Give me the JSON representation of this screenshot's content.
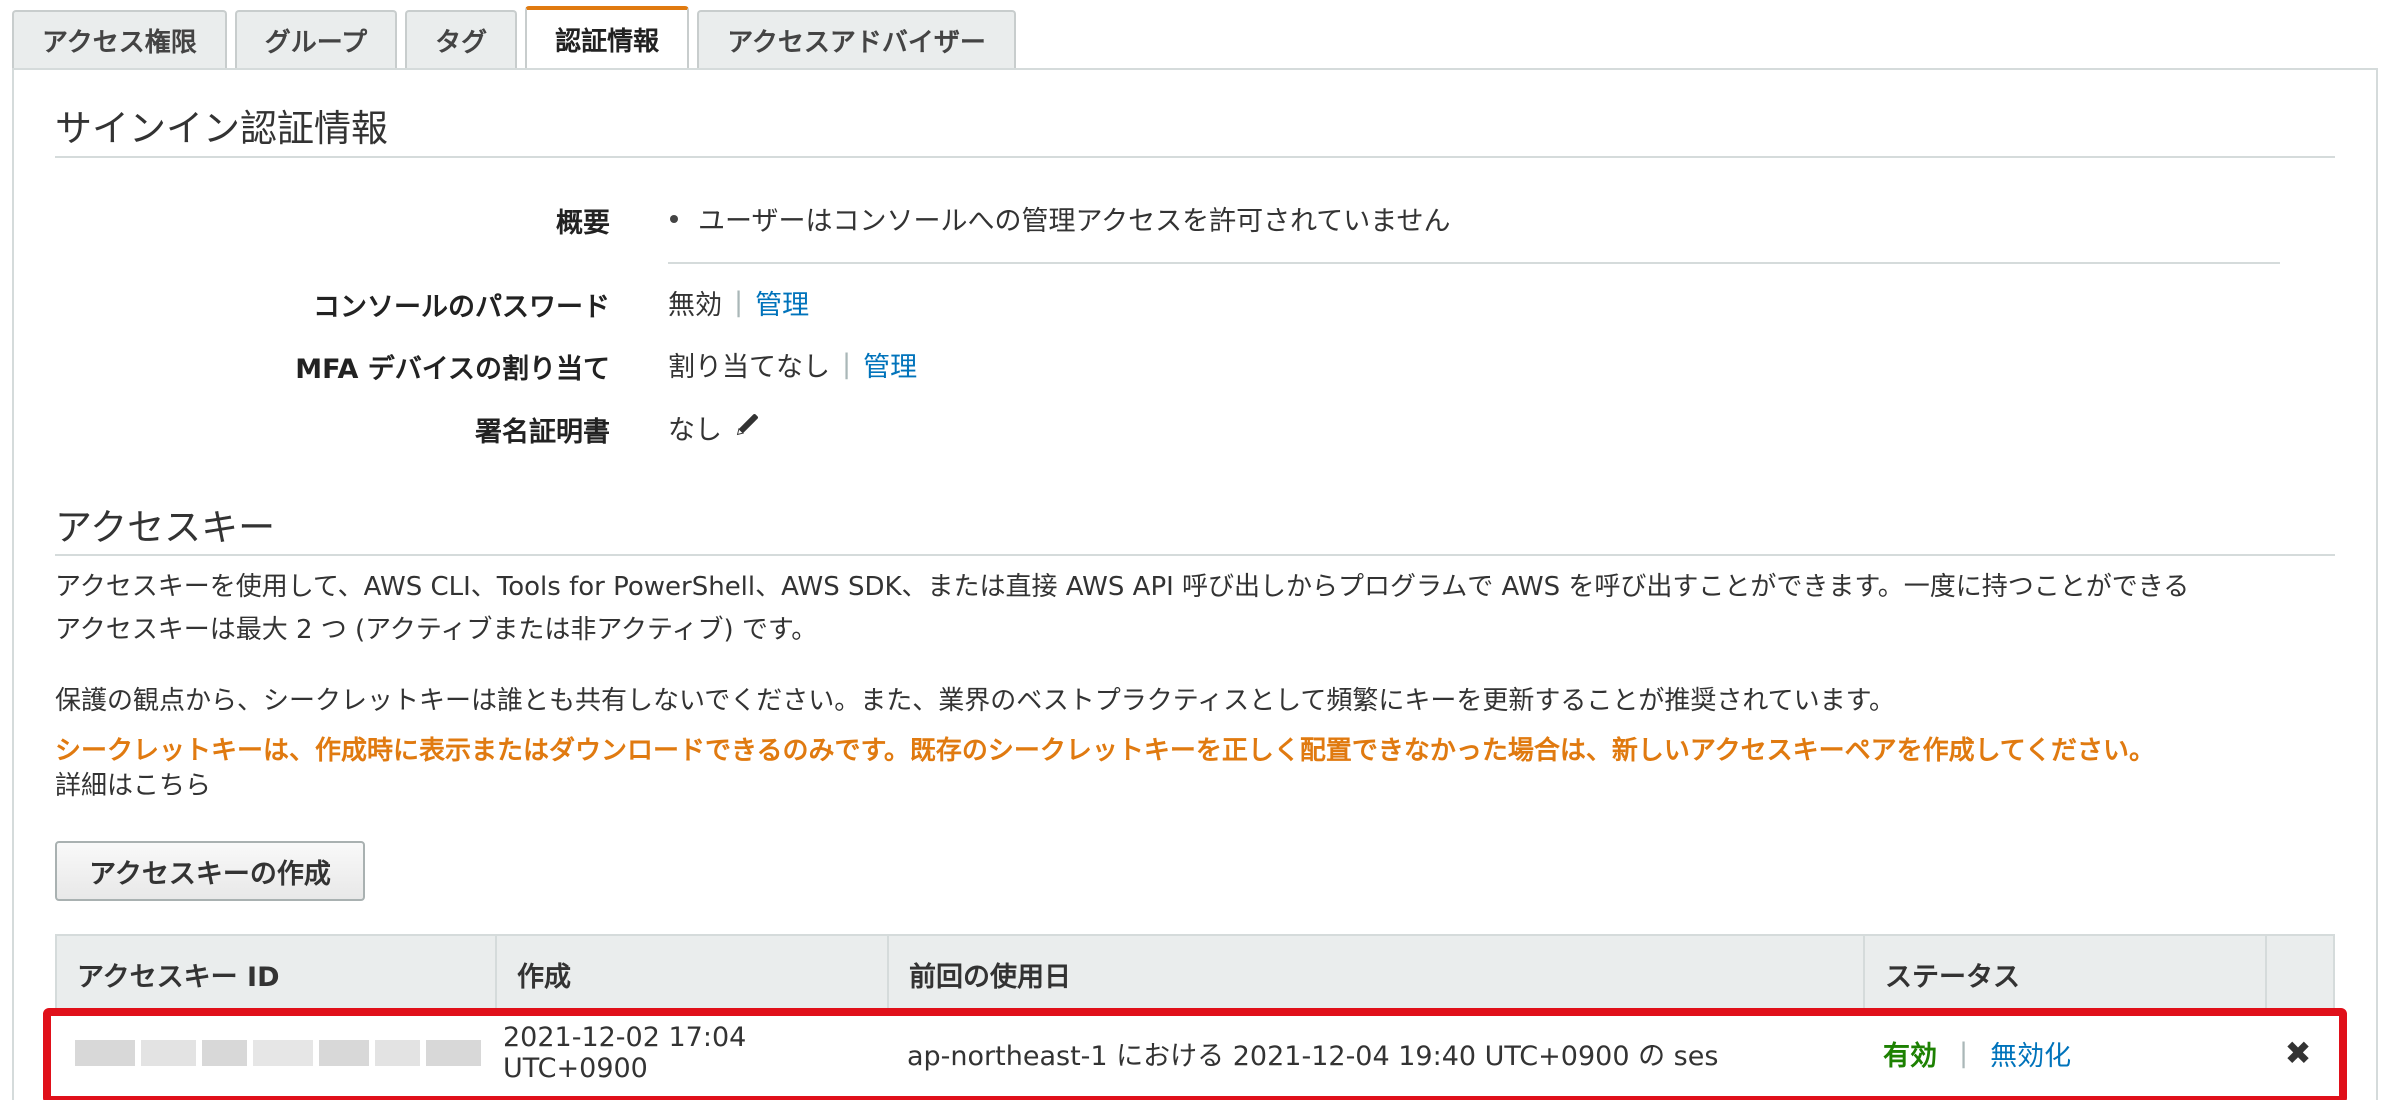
{
  "tabs": [
    {
      "label": "アクセス権限"
    },
    {
      "label": "グループ"
    },
    {
      "label": "タグ"
    },
    {
      "label": "認証情報"
    },
    {
      "label": "アクセスアドバイザー"
    }
  ],
  "active_tab_color": "#e07a10",
  "signin": {
    "title": "サインイン認証情報",
    "summary_label": "概要",
    "summary_text": "ユーザーはコンソールへの管理アクセスを許可されていません",
    "password_label": "コンソールのパスワード",
    "password_value": "無効",
    "password_link": "管理",
    "mfa_label": "MFA デバイスの割り当て",
    "mfa_value": "割り当てなし",
    "mfa_link": "管理",
    "cert_label": "署名証明書",
    "cert_value": "なし",
    "cert_icon": "pencil-icon"
  },
  "access_keys": {
    "title": "アクセスキー",
    "desc_line1": "アクセスキーを使用して、AWS CLI、Tools for PowerShell、AWS SDK、または直接 AWS API 呼び出しからプログラムで AWS を呼び出すことができます。一度に持つことができる",
    "desc_line2": "アクセスキーは最大 2 つ (アクティブまたは非アクティブ) です。",
    "security_note": "保護の観点から、シークレットキーは誰とも共有しないでください。また、業界のベストプラクティスとして頻繁にキーを更新することが推奨されています。",
    "warning": "シークレットキーは、作成時に表示またはダウンロードできるのみです。既存のシークレットキーを正しく配置できなかった場合は、新しいアクセスキーペアを作成してください。",
    "learn_more": "詳細はこちら",
    "create_button": "アクセスキーの作成",
    "table": {
      "headers": [
        "アクセスキー ID",
        "作成",
        "前回の使用日",
        "ステータス"
      ],
      "rows": [
        {
          "id_masked": true,
          "created": "2021-12-02 17:04 UTC+0900",
          "last_used": "ap-northeast-1 における 2021-12-04 19:40 UTC+0900 の ses",
          "status": "有効",
          "action": "無効化",
          "delete_icon": "close-icon"
        }
      ]
    }
  },
  "colors": {
    "link": "#0073bb",
    "warning": "#e07a10",
    "active_status": "#1d8102",
    "highlight_border": "#e0101a"
  }
}
